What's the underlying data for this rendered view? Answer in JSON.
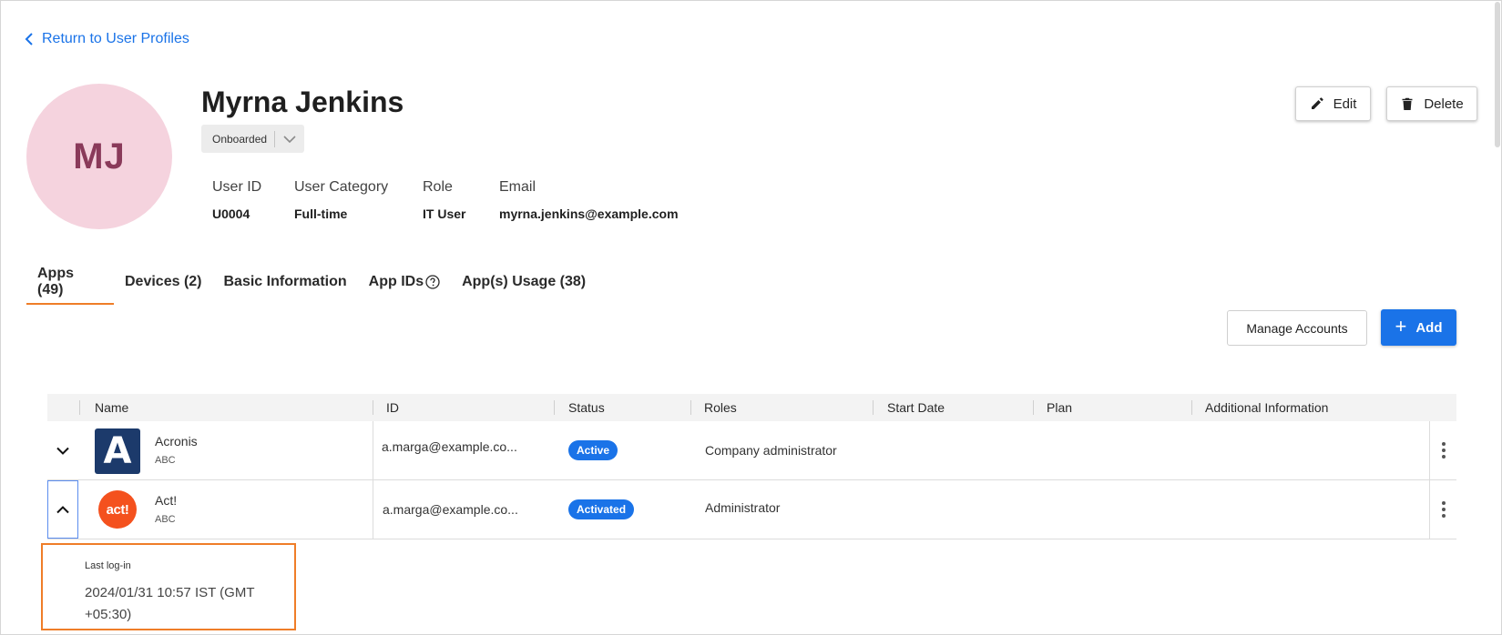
{
  "nav": {
    "back_label": "Return to User Profiles"
  },
  "profile": {
    "initials": "MJ",
    "name": "Myrna Jenkins",
    "status": "Onboarded",
    "fields": [
      {
        "label": "User ID",
        "value": "U0004"
      },
      {
        "label": "User Category",
        "value": "Full-time"
      },
      {
        "label": "Role",
        "value": "IT User"
      },
      {
        "label": "Email",
        "value": "myrna.jenkins@example.com"
      }
    ]
  },
  "actions": {
    "edit_label": "Edit",
    "delete_label": "Delete"
  },
  "tabs": [
    {
      "label": "Apps (49)",
      "active": true
    },
    {
      "label": "Devices (2)",
      "active": false
    },
    {
      "label": "Basic Information",
      "active": false
    },
    {
      "label": "App IDs",
      "active": false
    },
    {
      "label": "App(s) Usage (38)",
      "active": false
    }
  ],
  "toolbar": {
    "manage_label": "Manage Accounts",
    "add_label": "Add"
  },
  "table": {
    "columns": [
      "Name",
      "ID",
      "Status",
      "Roles",
      "Start Date",
      "Plan",
      "Additional Information"
    ],
    "rows": [
      {
        "name": "Acronis",
        "org": "ABC",
        "logo": "A",
        "id": "a.marga@example.co...",
        "status": "Active",
        "roles": "Company administrator",
        "start_date": "",
        "plan": "",
        "additional": "",
        "expanded": false
      },
      {
        "name": "Act!",
        "org": "ABC",
        "logo": "act!",
        "id": "a.marga@example.co...",
        "status": "Activated",
        "roles": "Administrator",
        "start_date": "",
        "plan": "",
        "additional": "",
        "expanded": true
      }
    ]
  },
  "expanded_detail": {
    "label": "Last log-in",
    "value": "2024/01/31 10:57 IST (GMT +05:30)"
  },
  "colors": {
    "accent": "#1a73e8",
    "tab_underline": "#ef7d28",
    "highlight_box": "#ef7d28",
    "avatar_bg": "#f5d3de",
    "avatar_text": "#8a3a5a",
    "acronis_logo_bg": "#1c3a6b",
    "act_logo_bg": "#f4511e"
  }
}
